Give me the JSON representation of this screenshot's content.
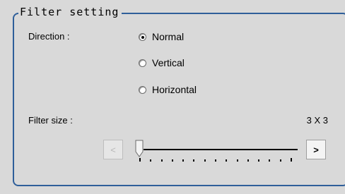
{
  "group": {
    "title": "Filter setting"
  },
  "direction": {
    "label": "Direction :",
    "options": [
      {
        "label": "Normal",
        "checked": true
      },
      {
        "label": "Vertical",
        "checked": false
      },
      {
        "label": "Horizontal",
        "checked": false
      }
    ]
  },
  "filter_size": {
    "label": "Filter size :",
    "value": "3 X 3",
    "slider_position": 0,
    "decrement_label": "<",
    "increment_label": ">"
  }
}
